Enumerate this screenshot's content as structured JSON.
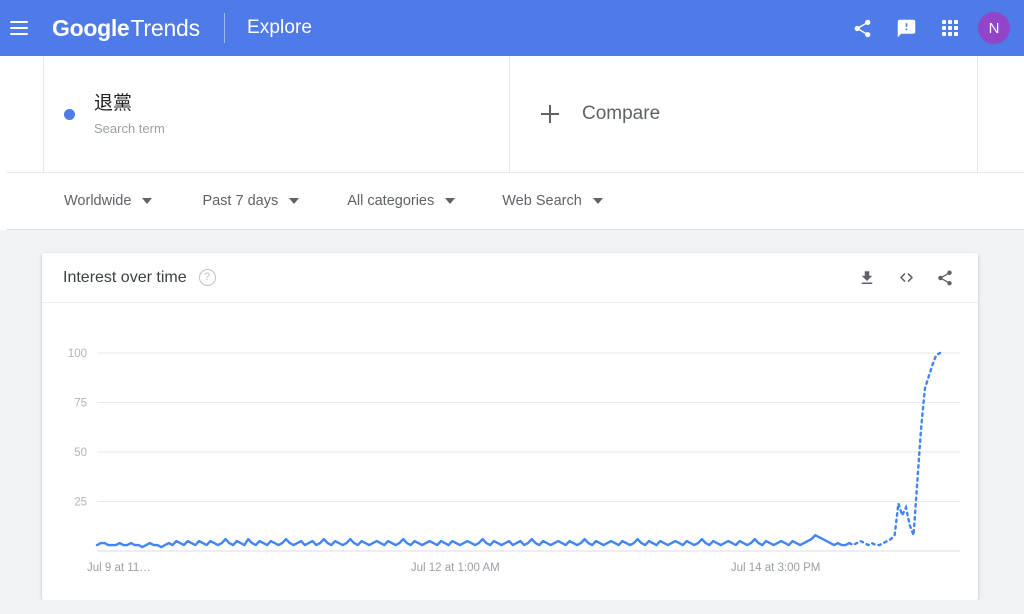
{
  "appbar": {
    "menu_icon": "hamburger-menu-icon",
    "brand_google": "Google",
    "brand_trends": "Trends",
    "explore": "Explore",
    "share_icon": "share-icon",
    "feedback_icon": "feedback-icon",
    "apps_icon": "apps-grid-icon",
    "avatar_initial": "N",
    "bg_color": "#4e7be8",
    "avatar_color": "#9245c8"
  },
  "search_terms": [
    {
      "term": "退黨",
      "type": "Search term",
      "color": "#4e7be8"
    }
  ],
  "compare": {
    "label": "Compare",
    "plus_icon": "plus-icon"
  },
  "filters": [
    {
      "label": "Worldwide",
      "caret_icon": "chevron-down-icon"
    },
    {
      "label": "Past 7 days",
      "caret_icon": "chevron-down-icon"
    },
    {
      "label": "All categories",
      "caret_icon": "chevron-down-icon"
    },
    {
      "label": "Web Search",
      "caret_icon": "chevron-down-icon"
    }
  ],
  "card": {
    "title": "Interest over time",
    "help_icon": "help-circle-icon",
    "help_glyph": "?",
    "actions": [
      {
        "name": "download-icon",
        "tooltip": "Download"
      },
      {
        "name": "embed-code-icon",
        "tooltip": "Embed"
      },
      {
        "name": "share-icon",
        "tooltip": "Share"
      }
    ]
  },
  "chart_data": {
    "type": "line",
    "title": "Interest over time",
    "xlabel": "",
    "ylabel": "",
    "ylim": [
      0,
      100
    ],
    "yticks": [
      25,
      50,
      75,
      100
    ],
    "ytick_labels": [
      "25",
      "50",
      "75",
      "100"
    ],
    "grid": true,
    "legend": false,
    "line_color": "#4285f4",
    "series_name": "退黨",
    "xtick_labels": [
      "Jul 9 at 11…",
      "Jul 12 at 1:00 AM",
      "Jul 14 at 3:00 PM"
    ],
    "xtick_positions": [
      0,
      0.425,
      0.805
    ],
    "partial_data_dashed_tail": true,
    "values": [
      3,
      4,
      4,
      3,
      3,
      3,
      4,
      3,
      3,
      4,
      3,
      3,
      2,
      3,
      4,
      3,
      3,
      2,
      3,
      4,
      3,
      5,
      4,
      3,
      5,
      4,
      3,
      5,
      4,
      3,
      5,
      4,
      3,
      4,
      6,
      4,
      3,
      5,
      4,
      3,
      6,
      4,
      3,
      5,
      4,
      3,
      5,
      4,
      3,
      4,
      6,
      4,
      3,
      4,
      5,
      3,
      4,
      5,
      3,
      4,
      6,
      4,
      3,
      5,
      4,
      3,
      4,
      6,
      4,
      3,
      5,
      4,
      3,
      4,
      5,
      4,
      3,
      5,
      4,
      3,
      4,
      6,
      4,
      3,
      5,
      4,
      3,
      4,
      5,
      4,
      3,
      5,
      4,
      3,
      5,
      4,
      3,
      4,
      5,
      4,
      3,
      4,
      6,
      4,
      3,
      5,
      4,
      3,
      4,
      5,
      3,
      4,
      5,
      3,
      4,
      6,
      4,
      3,
      5,
      4,
      3,
      4,
      5,
      4,
      3,
      5,
      4,
      3,
      4,
      6,
      4,
      3,
      5,
      4,
      3,
      4,
      5,
      4,
      3,
      5,
      4,
      3,
      4,
      6,
      4,
      3,
      5,
      4,
      3,
      5,
      4,
      3,
      4,
      5,
      4,
      3,
      5,
      4,
      3,
      4,
      6,
      4,
      3,
      5,
      4,
      3,
      4,
      5,
      4,
      3,
      5,
      4,
      3,
      4,
      6,
      4,
      3,
      5,
      4,
      3,
      4,
      5,
      4,
      3,
      5,
      4,
      3,
      4,
      5,
      6,
      8,
      7,
      6,
      5,
      4,
      3,
      4,
      3,
      3,
      4,
      3,
      4,
      5,
      4,
      3,
      4,
      3,
      3,
      4,
      5,
      6,
      8,
      24,
      18,
      22,
      13,
      8,
      35,
      62,
      82,
      88,
      94,
      99,
      100
    ],
    "dashed_from_index": 199,
    "peak_value": 100,
    "baseline_typical": 4
  }
}
